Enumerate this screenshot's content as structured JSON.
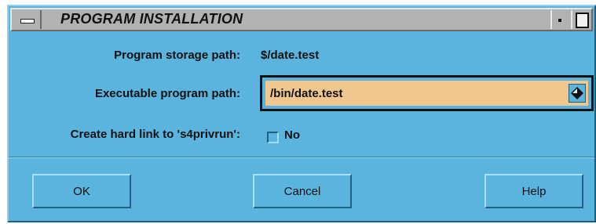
{
  "window": {
    "title": "PROGRAM INSTALLATION"
  },
  "form": {
    "storage_label": "Program storage path:",
    "storage_value": "$/date.test",
    "exec_label": "Executable program path:",
    "exec_value": "/bin/date.test",
    "hardlink_label": "Create hard link to 's4privrun':",
    "hardlink_value": "No",
    "hardlink_checked": false
  },
  "buttons": {
    "ok": "OK",
    "cancel": "Cancel",
    "help": "Help"
  },
  "colors": {
    "dialog_bg": "#5ab4de",
    "titlebar": "#b2b2b2",
    "input_bg": "#f1c790"
  },
  "icons": {
    "window_menu": "window-menu-icon",
    "minimize": "minimize-icon",
    "maximize": "maximize-icon",
    "combo_arrow": "diamond-arrow-icon"
  }
}
